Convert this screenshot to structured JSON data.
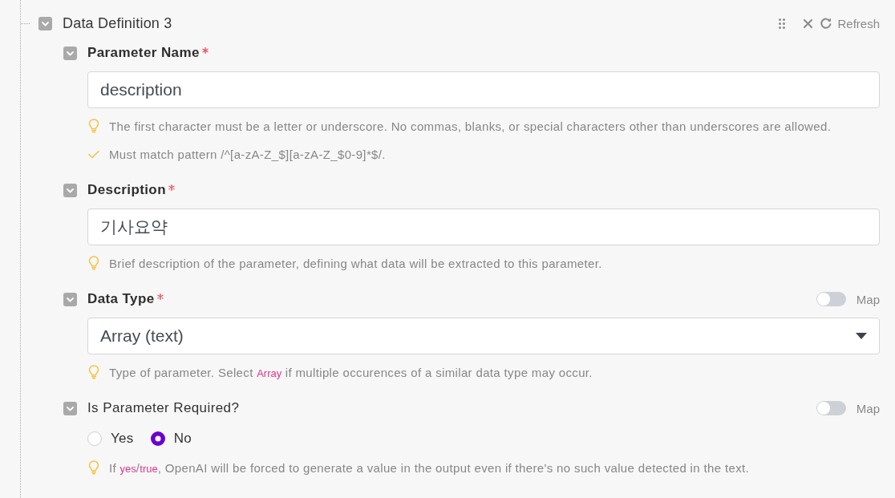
{
  "section": {
    "title": "Data Definition 3",
    "expanded": true,
    "refresh_label": "Refresh"
  },
  "fields": [
    {
      "kind": "text",
      "label": "Parameter Name",
      "required": true,
      "expanded": true,
      "value": "description",
      "hints": [
        {
          "kind": "tip",
          "text": "The first character must be a letter or underscore. No commas, blanks, or special characters other than underscores are allowed."
        },
        {
          "kind": "check",
          "text": "Must match pattern /^[a-zA-Z_$][a-zA-Z_$0-9]*$/."
        }
      ]
    },
    {
      "kind": "text",
      "label": "Description",
      "required": true,
      "expanded": true,
      "value": "기사요약",
      "hints": [
        {
          "kind": "tip",
          "text": "Brief description of the parameter, defining what data will be extracted to this parameter."
        }
      ]
    },
    {
      "kind": "select",
      "label": "Data Type",
      "required": true,
      "expanded": true,
      "map": {
        "label": "Map",
        "on": false
      },
      "value": "Array (text)",
      "hints": [
        {
          "kind": "tip",
          "text": "Type of parameter. Select *Array* if multiple occurences of a similar data type may occur."
        }
      ]
    },
    {
      "kind": "radio",
      "label": "Is Parameter Required?",
      "required": false,
      "expanded": true,
      "map": {
        "label": "Map",
        "on": false
      },
      "options": [
        {
          "label": "Yes",
          "selected": false
        },
        {
          "label": "No",
          "selected": true
        }
      ],
      "hints": [
        {
          "kind": "tip",
          "text": "If *yes*/*true*, OpenAI will be forced to generate a value in the output even if there's no such value detected in the text."
        }
      ]
    }
  ]
}
